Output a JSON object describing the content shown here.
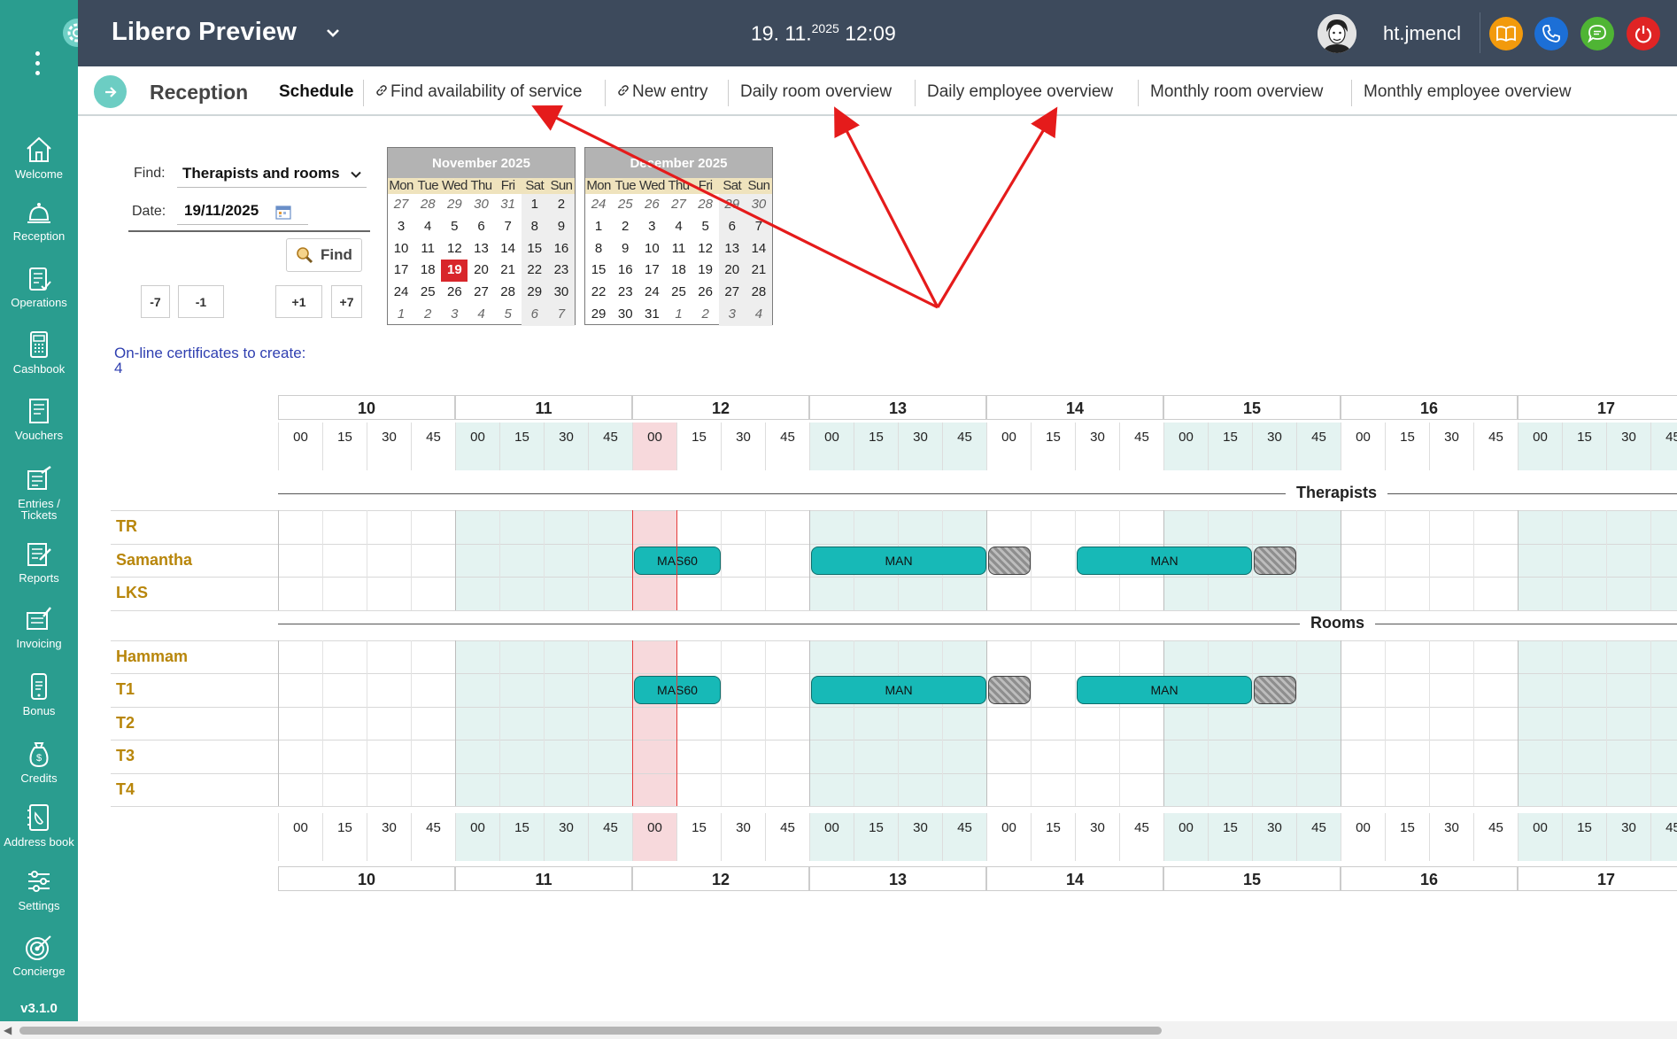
{
  "app": {
    "title": "Libero Preview",
    "version": "v3.1.0",
    "clock_date": "19. 11.",
    "clock_year": "2025",
    "clock_time": "12:09",
    "username": "ht.jmencl"
  },
  "colors": {
    "sidebar": "#2a9d8f",
    "topbar": "#3d4a5c",
    "appointment": "#17b9b7",
    "row_label": "#b8860b",
    "today": "#d8262b",
    "annotation_arrow": "#e51b1b"
  },
  "sidebar": {
    "items": [
      {
        "label": "Welcome",
        "icon": "home-icon"
      },
      {
        "label": "Reception",
        "icon": "bell-icon"
      },
      {
        "label": "Operations",
        "icon": "clipboard-icon"
      },
      {
        "label": "Cashbook",
        "icon": "calculator-icon"
      },
      {
        "label": "Vouchers",
        "icon": "voucher-icon"
      },
      {
        "label": "Entries /\nTickets",
        "icon": "ticket-icon"
      },
      {
        "label": "Reports",
        "icon": "report-icon"
      },
      {
        "label": "Invoicing",
        "icon": "invoice-icon"
      },
      {
        "label": "Bonus",
        "icon": "phone-card-icon"
      },
      {
        "label": "Credits",
        "icon": "money-bag-icon"
      },
      {
        "label": "Address book",
        "icon": "address-book-icon"
      },
      {
        "label": "Settings",
        "icon": "sliders-icon"
      },
      {
        "label": "Concierge",
        "icon": "target-icon"
      }
    ]
  },
  "nav": {
    "section": "Reception",
    "tabs": [
      {
        "label": "Schedule",
        "active": true,
        "link_icon": false
      },
      {
        "label": "Find availability of service",
        "active": false,
        "link_icon": true
      },
      {
        "label": "New entry",
        "active": false,
        "link_icon": true
      },
      {
        "label": "Daily room overview",
        "active": false,
        "link_icon": false
      },
      {
        "label": "Daily employee overview",
        "active": false,
        "link_icon": false
      },
      {
        "label": "Monthly room overview",
        "active": false,
        "link_icon": false
      },
      {
        "label": "Monthly employee overview",
        "active": false,
        "link_icon": false
      }
    ]
  },
  "search": {
    "find_label": "Find:",
    "find_value": "Therapists and rooms",
    "date_label": "Date:",
    "date_value": "19/11/2025",
    "find_button": "Find",
    "steps": [
      "-7",
      "-1",
      "+1",
      "+7"
    ],
    "certificates_text": "On-line certificates to create: 4"
  },
  "calendars": [
    {
      "title": "November 2025",
      "dow": [
        "Mon",
        "Tue",
        "Wed",
        "Thu",
        "Fri",
        "Sat",
        "Sun"
      ],
      "weeks": [
        [
          "27",
          "28",
          "29",
          "30",
          "31",
          "1",
          "2"
        ],
        [
          "3",
          "4",
          "5",
          "6",
          "7",
          "8",
          "9"
        ],
        [
          "10",
          "11",
          "12",
          "13",
          "14",
          "15",
          "16"
        ],
        [
          "17",
          "18",
          "19",
          "20",
          "21",
          "22",
          "23"
        ],
        [
          "24",
          "25",
          "26",
          "27",
          "28",
          "29",
          "30"
        ],
        [
          "1",
          "2",
          "3",
          "4",
          "5",
          "6",
          "7"
        ]
      ],
      "other_month": [
        [
          0,
          0
        ],
        [
          0,
          1
        ],
        [
          0,
          2
        ],
        [
          0,
          3
        ],
        [
          0,
          4
        ],
        [
          5,
          0
        ],
        [
          5,
          1
        ],
        [
          5,
          2
        ],
        [
          5,
          3
        ],
        [
          5,
          4
        ],
        [
          5,
          5
        ],
        [
          5,
          6
        ]
      ],
      "today": [
        3,
        2
      ]
    },
    {
      "title": "December 2025",
      "dow": [
        "Mon",
        "Tue",
        "Wed",
        "Thu",
        "Fri",
        "Sat",
        "Sun"
      ],
      "weeks": [
        [
          "24",
          "25",
          "26",
          "27",
          "28",
          "29",
          "30"
        ],
        [
          "1",
          "2",
          "3",
          "4",
          "5",
          "6",
          "7"
        ],
        [
          "8",
          "9",
          "10",
          "11",
          "12",
          "13",
          "14"
        ],
        [
          "15",
          "16",
          "17",
          "18",
          "19",
          "20",
          "21"
        ],
        [
          "22",
          "23",
          "24",
          "25",
          "26",
          "27",
          "28"
        ],
        [
          "29",
          "30",
          "31",
          "1",
          "2",
          "3",
          "4"
        ]
      ],
      "other_month": [
        [
          0,
          0
        ],
        [
          0,
          1
        ],
        [
          0,
          2
        ],
        [
          0,
          3
        ],
        [
          0,
          4
        ],
        [
          0,
          5
        ],
        [
          0,
          6
        ],
        [
          5,
          3
        ],
        [
          5,
          4
        ],
        [
          5,
          5
        ],
        [
          5,
          6
        ]
      ],
      "today": null
    }
  ],
  "schedule": {
    "hours": [
      "10",
      "11",
      "12",
      "13",
      "14",
      "15",
      "16",
      "17"
    ],
    "minutes": [
      "00",
      "15",
      "30",
      "45"
    ],
    "current_slot_index": 8,
    "sections": [
      {
        "title": "Therapists",
        "rows": [
          {
            "name": "TR",
            "appointments": []
          },
          {
            "name": "Samantha",
            "appointments": [
              {
                "label": "MAS60",
                "start": 8,
                "end": 10,
                "type": "service"
              },
              {
                "label": "MAN",
                "start": 12,
                "end": 16,
                "type": "service"
              },
              {
                "label": "",
                "start": 16,
                "end": 17,
                "type": "blocked"
              },
              {
                "label": "MAN",
                "start": 18,
                "end": 22,
                "type": "service"
              },
              {
                "label": "",
                "start": 22,
                "end": 23,
                "type": "blocked"
              }
            ]
          },
          {
            "name": "LKS",
            "appointments": []
          }
        ]
      },
      {
        "title": "Rooms",
        "rows": [
          {
            "name": "Hammam",
            "appointments": []
          },
          {
            "name": "T1",
            "appointments": [
              {
                "label": "MAS60",
                "start": 8,
                "end": 10,
                "type": "service"
              },
              {
                "label": "MAN",
                "start": 12,
                "end": 16,
                "type": "service"
              },
              {
                "label": "",
                "start": 16,
                "end": 17,
                "type": "blocked"
              },
              {
                "label": "MAN",
                "start": 18,
                "end": 22,
                "type": "service"
              },
              {
                "label": "",
                "start": 22,
                "end": 23,
                "type": "blocked"
              }
            ]
          },
          {
            "name": "T2",
            "appointments": []
          },
          {
            "name": "T3",
            "appointments": []
          },
          {
            "name": "T4",
            "appointments": []
          }
        ]
      }
    ]
  }
}
